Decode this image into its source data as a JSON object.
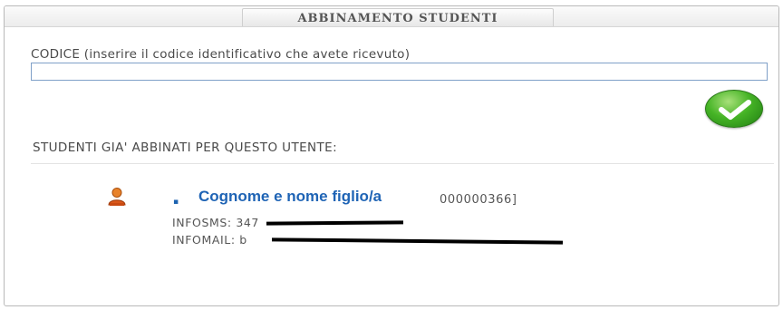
{
  "dialog": {
    "title": "ABBINAMENTO STUDENTI"
  },
  "code_section": {
    "label": "CODICE (inserire il codice identificativo che avete ricevuto)",
    "input_value": "",
    "input_placeholder": ""
  },
  "confirm_button": {
    "icon": "check-icon",
    "color": "#46b426"
  },
  "associated": {
    "label": "STUDENTI GIA' ABBINATI PER QUESTO UTENTE:",
    "students": [
      {
        "icon": "user-icon",
        "bullet": "▪",
        "name": "Cognome e nome figlio/a",
        "code": "000000366]",
        "sms_label": "INFOSMS: ",
        "sms_value": "347",
        "mail_label": "INFOMAIL: ",
        "mail_value": "b"
      }
    ]
  },
  "colors": {
    "name_color": "#1f64b5",
    "redaction": "#000000"
  }
}
